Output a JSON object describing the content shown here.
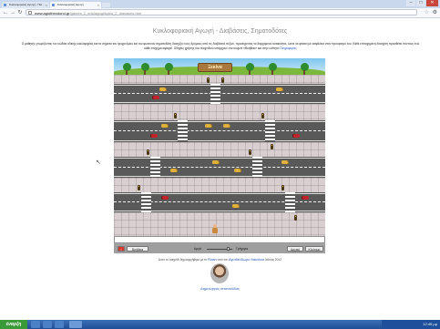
{
  "browser": {
    "tabs": [
      {
        "label": "Κυκλοφοριακή Αγωγή - Παι...",
        "active": false
      },
      {
        "label": "Κυκλοφοριακή Αγωγή",
        "active": true
      }
    ],
    "url_host": "www.agiotheodoroi.gr",
    "url_path": "/games_2_edu/agogi/kyklo_2_diavaseis.htm",
    "window_controls": [
      "–",
      "□",
      "✕"
    ]
  },
  "page": {
    "title": "Κυκλοφοριακή Αγωγή - Διαβάσεις, Σηματοδότες",
    "intro": "Ο μαθητής γνωρίζοντας τον κώδικα οδικής κυκλοφορίας και τα σήματα του τροχονόμου και του φωτεινού σηματοδότη διασχίζει τους δρόμους από τις διαβάσεις πεζών, προσέχοντας τα διερχόμενα αυτοκίνητα, ώστε να φτάσει με ασφάλεια στον προορισμό του. Κάθε επιτυχημένη διάσχιση προσθέτει πόντους ενώ κάθε ατύχημα αφαιρεί. Οδηγίες χρήσης του παιχνιδιού υπάρχουν στο κουμπί «Βοήθεια» και στην ενότητα",
    "intro_link": "Πληροφορίες"
  },
  "game": {
    "start_label": "Ξεκίνα",
    "buttons": {
      "help": "Βοήθεια",
      "speed_label": "Αργά",
      "fast_label": "Γρήγορα",
      "reset": "Αρχική",
      "close": "Κλείσιμο"
    },
    "speed_level": 0.85,
    "message": ""
  },
  "footer": {
    "credits_prefix": "Αυτό το παιχνίδι δημιουργήθηκε με το",
    "credits_link1": "Flash",
    "credits_mid": "από τον",
    "credits_link2": "Αγιοθεόδωρο Νικόλαο",
    "credits_suffix": "Ιούνιος 2012",
    "author_link": "Δημιουργός ιστοσελίδας"
  },
  "taskbar": {
    "start": "έναρξη",
    "clock": "12:45 μμ"
  },
  "colors": {
    "road": "#595959",
    "sidewalk": "#d9cfd1",
    "link": "#2255bb",
    "taxi": "#e1b03a",
    "car": "#c0242a"
  }
}
